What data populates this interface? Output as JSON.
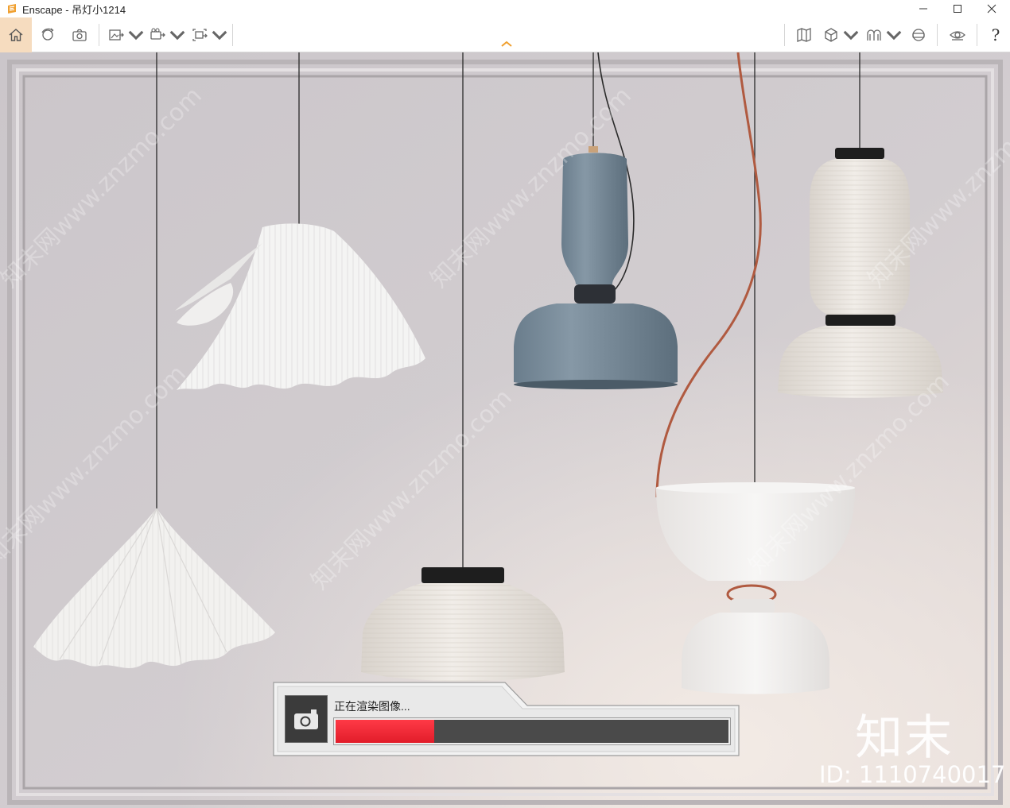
{
  "window": {
    "title": "Enscape - 吊灯小1214",
    "minimize_icon": "minimize-icon",
    "maximize_icon": "maximize-icon",
    "close_icon": "close-icon"
  },
  "toolbar": {
    "left_tools": [
      {
        "name": "home",
        "icon": "home-icon",
        "active": true
      },
      {
        "name": "orbit",
        "icon": "orbit-icon"
      },
      {
        "name": "screenshot",
        "icon": "camera-icon"
      },
      {
        "name": "batch-render",
        "icon": "image-export-icon",
        "dropdown": true
      },
      {
        "name": "video-export",
        "icon": "video-export-icon",
        "dropdown": true
      },
      {
        "name": "panorama-export",
        "icon": "panorama-export-icon",
        "dropdown": true
      }
    ],
    "right_tools": [
      {
        "name": "map",
        "icon": "map-icon"
      },
      {
        "name": "asset-library",
        "icon": "cube-icon",
        "dropdown": true
      },
      {
        "name": "views",
        "icon": "views-icon",
        "dropdown": true
      },
      {
        "name": "vr",
        "icon": "vr-headset-icon"
      },
      {
        "name": "visual-settings",
        "icon": "eye-icon"
      },
      {
        "name": "help",
        "icon": "help-icon",
        "label": "?"
      }
    ],
    "accent_color": "#f0a030",
    "home_highlight": "#f6dcbf"
  },
  "render_dialog": {
    "status_text": "正在渲染图像...",
    "progress": 0.25,
    "progress_color": "#ff2c3a",
    "icon": "camera-icon"
  },
  "watermark": {
    "brand": "知末",
    "id_text": "ID: 1110740017",
    "site": "知末网www.znzmo.com"
  }
}
